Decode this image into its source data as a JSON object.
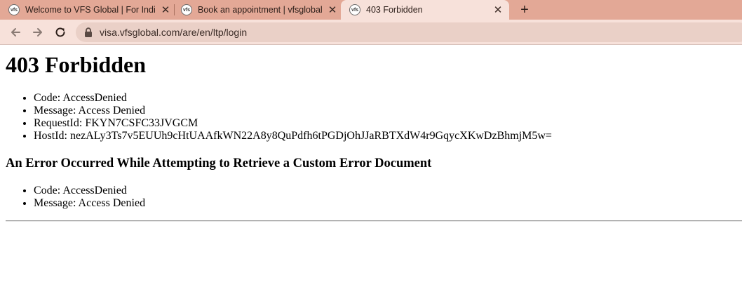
{
  "browser": {
    "tabs": [
      {
        "title": "Welcome to VFS Global | For Indi",
        "favicon": "vfs-favicon-icon",
        "active": false
      },
      {
        "title": "Book an appointment | vfsglobal",
        "favicon": "vfs-favicon-icon",
        "active": false
      },
      {
        "title": "403 Forbidden",
        "favicon": "vfs-favicon-icon",
        "active": true
      }
    ],
    "new_tab_label": "+",
    "close_glyph": "✕",
    "url": "visa.vfsglobal.com/are/en/ltp/login",
    "colors": {
      "tabstrip": "#e3a896",
      "active_tab": "#f7e1da",
      "omnibox": "#ead0c7"
    }
  },
  "page": {
    "title": "403 Forbidden",
    "details": [
      "Code: AccessDenied",
      "Message: Access Denied",
      "RequestId: FKYN7CSFC33JVGCM",
      "HostId: nezALy3Ts7v5EUUh9cHtUAAfkWN22A8y8QuPdfh6tPGDjOhJJaRBTXdW4r9GqycXKwDzBhmjM5w="
    ],
    "error_heading": "An Error Occurred While Attempting to Retrieve a Custom Error Document",
    "error_details": [
      "Code: AccessDenied",
      "Message: Access Denied"
    ]
  }
}
